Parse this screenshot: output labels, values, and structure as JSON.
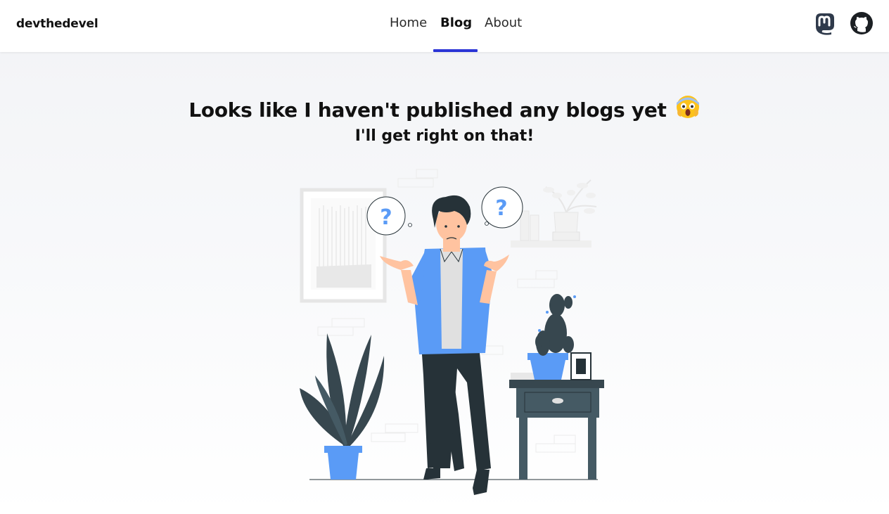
{
  "brand": {
    "name": "devthedevel"
  },
  "nav": {
    "links": [
      {
        "label": "Home"
      },
      {
        "label": "Blog",
        "active": true
      },
      {
        "label": "About"
      }
    ]
  },
  "social": {
    "mastodon_icon": "mastodon-icon",
    "github_icon": "github-icon"
  },
  "main": {
    "headline": "Looks like I haven't published any blogs yet",
    "headline_emoji": "face-screaming-in-fear",
    "subhead": "I'll get right on that!",
    "illustration": "confused-person-shrugging"
  },
  "colors": {
    "accent": "#2b35d6",
    "illustration_blue": "#5a9bf6",
    "illustration_dark": "#263238"
  }
}
